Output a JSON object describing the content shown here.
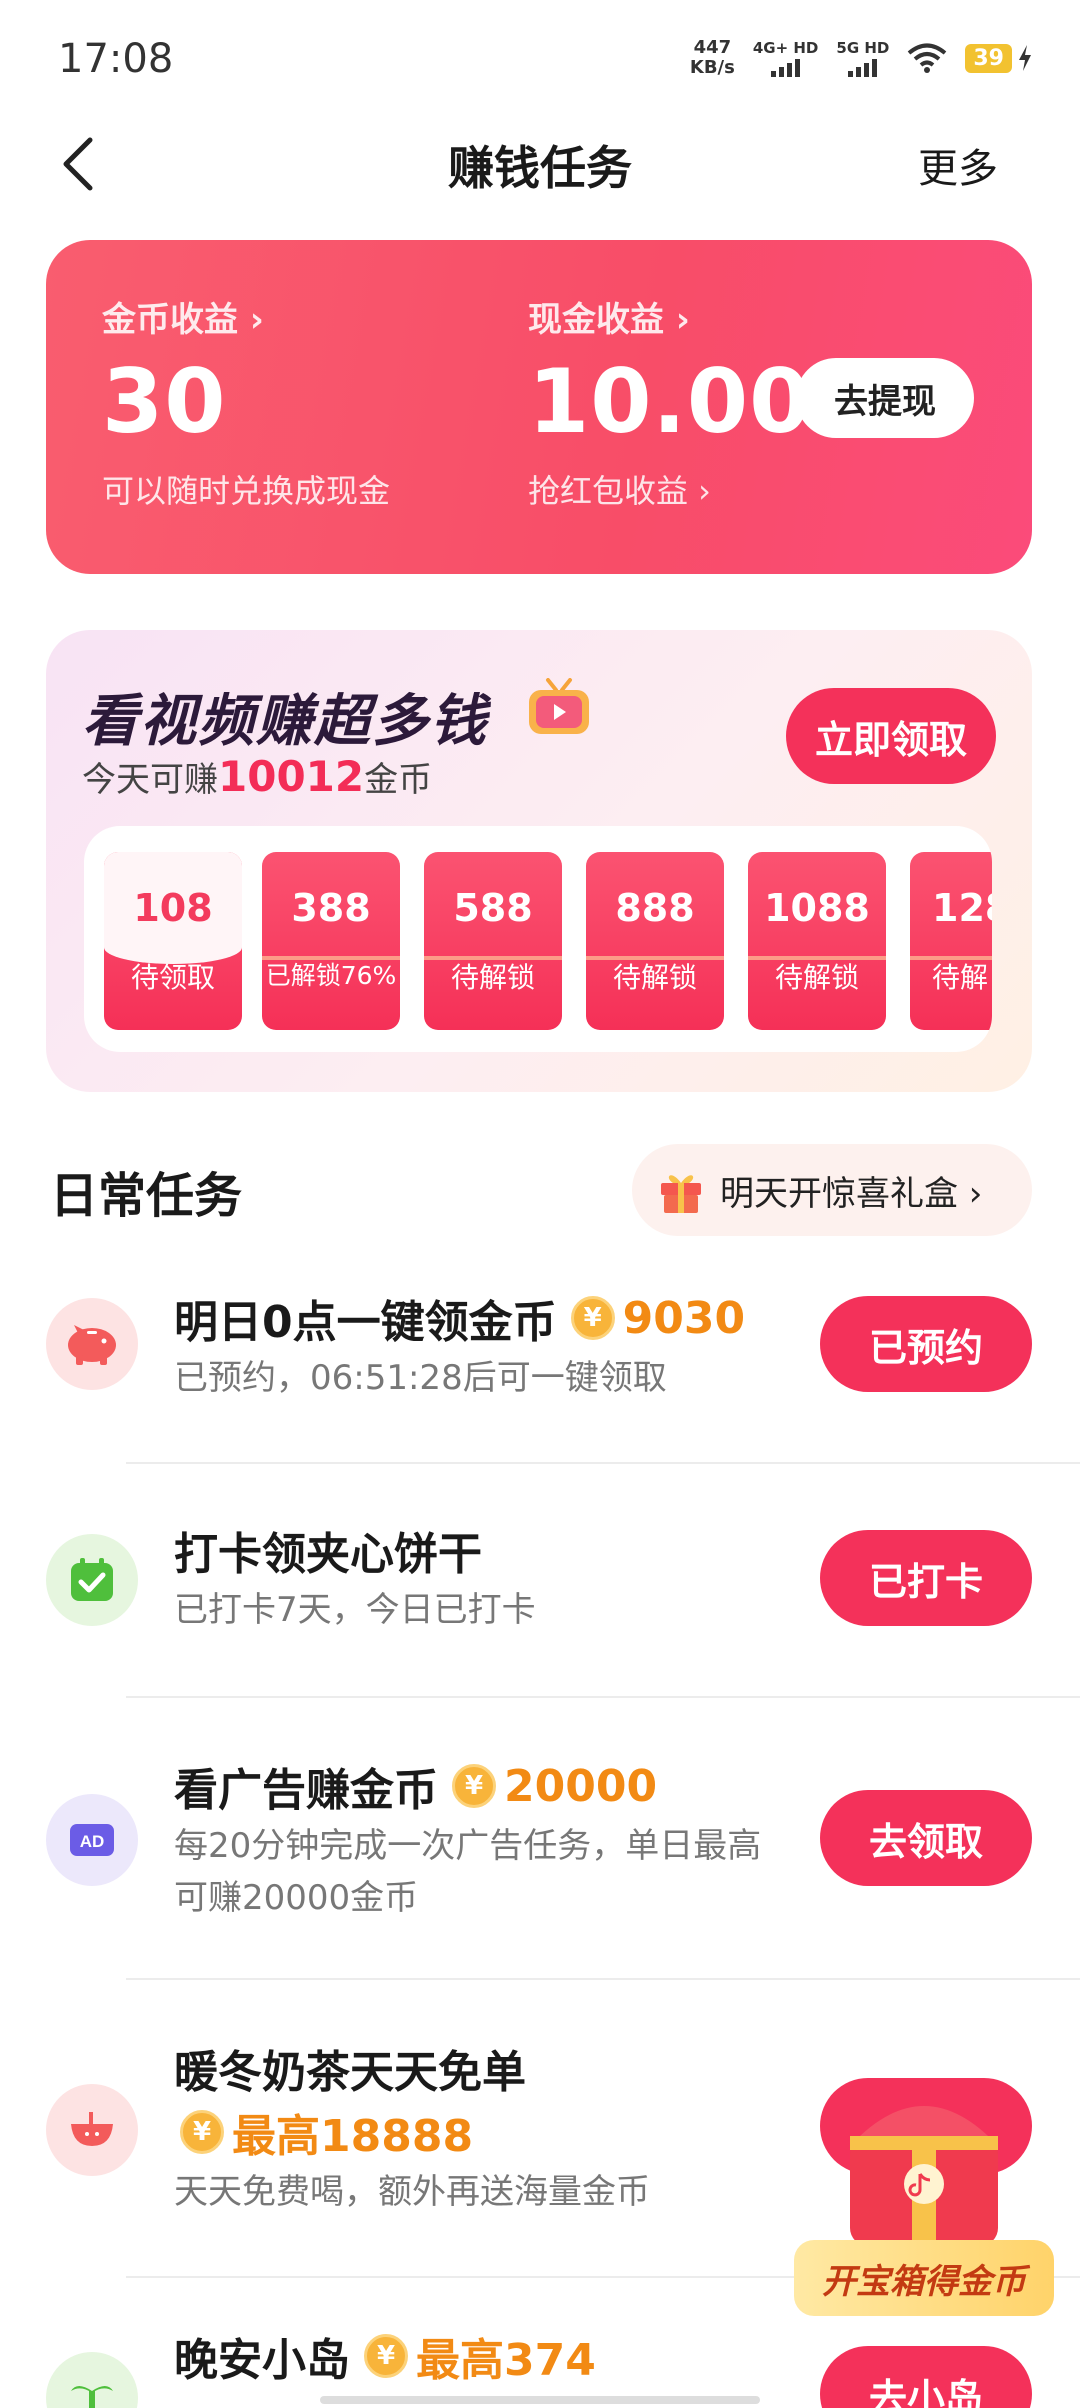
{
  "status_bar": {
    "time": "17:08",
    "net_speed_value": "447",
    "net_speed_unit": "KB/s",
    "signal1": "4G+ HD",
    "signal2": "5G HD",
    "battery": "39"
  },
  "nav": {
    "title": "赚钱任务",
    "more": "更多"
  },
  "earnings": {
    "coin_label": "金币收益 ›",
    "coin_value": "30",
    "coin_sub": "可以随时兑换成现金",
    "cash_label": "现金收益 ›",
    "cash_value": "10.00",
    "cash_sub": "抢红包收益 ›",
    "withdraw_label": "去提现"
  },
  "video_task": {
    "title": "看视频赚超多钱",
    "sub_prefix": "今天可赚",
    "sub_amount": "10012",
    "sub_suffix": "金币",
    "claim_label": "立即领取",
    "tiers": [
      {
        "amount": "108",
        "status": "待领取"
      },
      {
        "amount": "388",
        "status": "已解锁76%"
      },
      {
        "amount": "588",
        "status": "待解锁"
      },
      {
        "amount": "888",
        "status": "待解锁"
      },
      {
        "amount": "1088",
        "status": "待解锁"
      },
      {
        "amount": "128",
        "status": "待解"
      }
    ]
  },
  "daily": {
    "header": "日常任务",
    "gift_label": "明天开惊喜礼盒 ›",
    "tasks": [
      {
        "title": "明日0点一键领金币",
        "coin": "9030",
        "desc": "已预约，06:51:28后可一键领取",
        "button": "已预约",
        "icon": "piggy-bank-icon"
      },
      {
        "title": "打卡领夹心饼干",
        "desc": "已打卡7天，今日已打卡",
        "button": "已打卡",
        "icon": "calendar-check-icon"
      },
      {
        "title": "看广告赚金币",
        "coin": "20000",
        "desc": "每20分钟完成一次广告任务，单日最高可赚20000金币",
        "button": "去领取",
        "icon": "ad-icon"
      },
      {
        "title": "暖冬奶茶天天免单",
        "coin": "最高18888",
        "desc": "天天免费喝，额外再送海量金币",
        "icon": "milk-tea-icon"
      },
      {
        "title": "晚安小岛",
        "coin": "最高374",
        "button": "去小岛",
        "icon": "island-icon"
      }
    ]
  },
  "treasure": {
    "label": "开宝箱得金币"
  },
  "colors": {
    "accent": "#f4315a",
    "coin": "#f28a14"
  }
}
